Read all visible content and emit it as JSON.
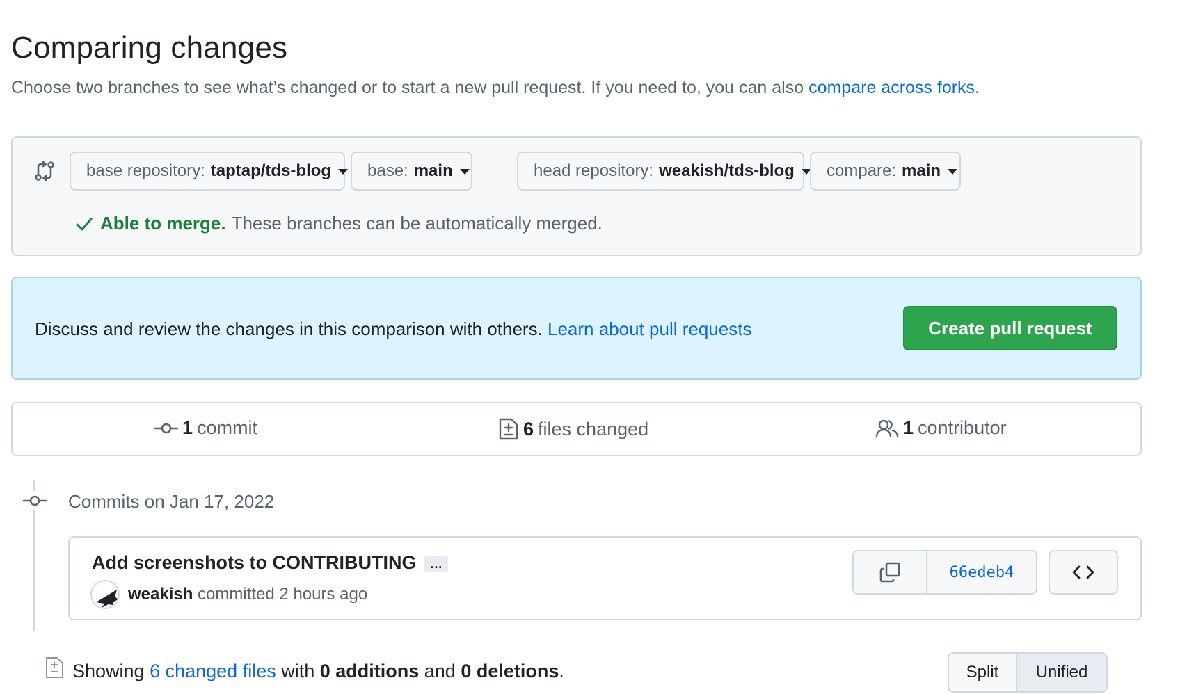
{
  "header": {
    "title": "Comparing changes",
    "subtitle": "Choose two branches to see what’s changed or to start a new pull request. If you need to, you can also ",
    "subtitle_link": "compare across forks",
    "subtitle_end": "."
  },
  "range": {
    "base_repo_label": "base repository:",
    "base_repo_value": "taptap/tds-blog",
    "base_label": "base:",
    "base_value": "main",
    "head_repo_label": "head repository:",
    "head_repo_value": "weakish/tds-blog",
    "compare_label": "compare:",
    "compare_value": "main",
    "merge_status": "Able to merge.",
    "merge_detail": "These branches can be automatically merged."
  },
  "banner": {
    "text": "Discuss and review the changes in this comparison with others. ",
    "link": "Learn about pull requests",
    "button": "Create pull request"
  },
  "summary": {
    "commits_count": "1",
    "commits_label": "commit",
    "files_count": "6",
    "files_label": "files changed",
    "contributors_count": "1",
    "contributors_label": "contributor"
  },
  "commits": {
    "date_heading": "Commits on Jan 17, 2022",
    "items": [
      {
        "title": "Add screenshots to CONTRIBUTING",
        "ellipsis": "…",
        "author": "weakish",
        "meta": " committed 2 hours ago",
        "sha": "66edeb4"
      }
    ]
  },
  "diff_summary": {
    "prefix": "Showing ",
    "files_link": "6 changed files",
    "mid1": " with ",
    "additions": "0 additions",
    "mid2": " and ",
    "deletions": "0 deletions",
    "suffix": ".",
    "split_label": "Split",
    "unified_label": "Unified"
  },
  "colors": {
    "accent": "#0969da",
    "success": "#1a7f37",
    "primary_button": "#2da44e",
    "banner_bg": "#ddf4ff"
  }
}
